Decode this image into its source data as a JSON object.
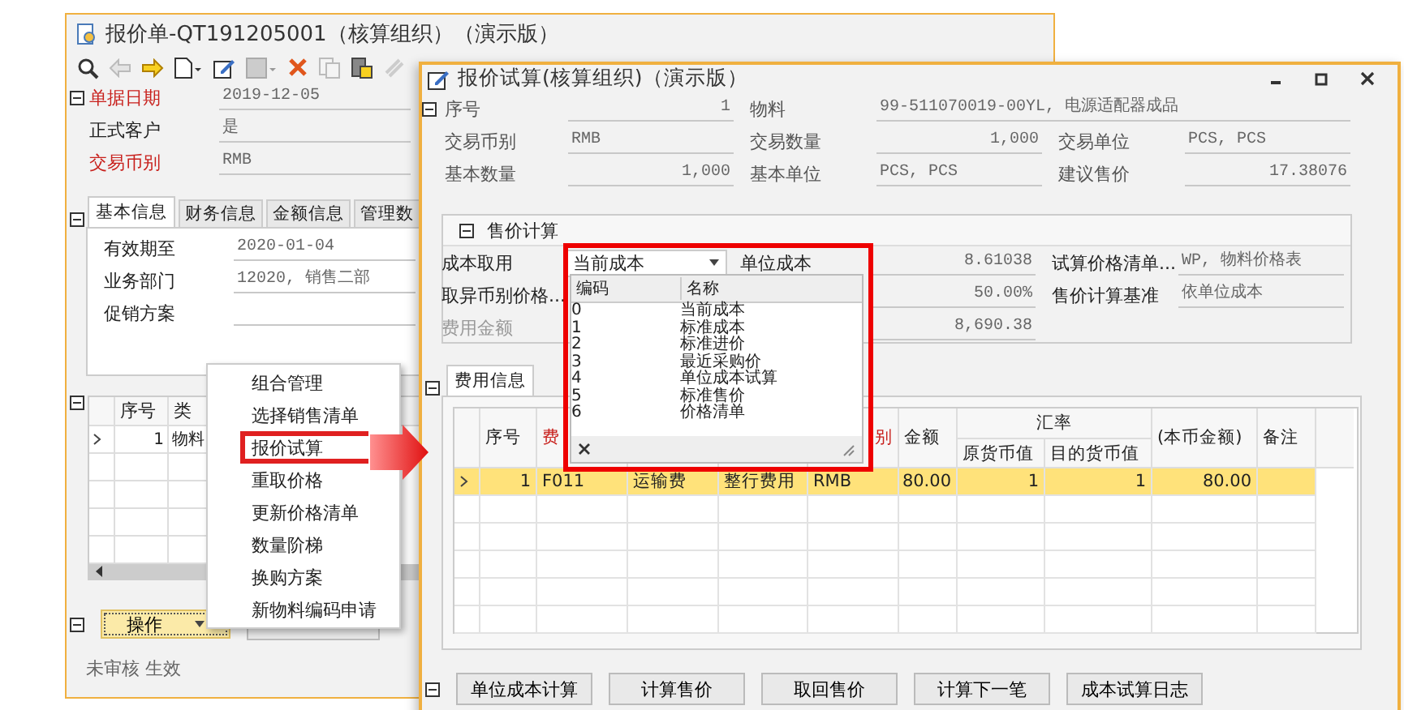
{
  "back_window": {
    "title": "报价单-QT191205001（核算组织）（演示版）",
    "header_fields": [
      {
        "label": "单据日期",
        "value": "2019-12-05",
        "required": true
      },
      {
        "label": "正式客户",
        "value": "是",
        "required": false
      },
      {
        "label": "交易币别",
        "value": "RMB",
        "required": true
      }
    ],
    "tabs": [
      {
        "label": "基本信息",
        "selected": true
      },
      {
        "label": "财务信息",
        "selected": false
      },
      {
        "label": "金额信息",
        "selected": false
      },
      {
        "label": "管理数",
        "selected": false
      }
    ],
    "tab_fields": [
      {
        "label": "有效期至",
        "value": "2020-01-04"
      },
      {
        "label": "业务部门",
        "value": "12020, 销售二部"
      },
      {
        "label": "促销方案"
      }
    ],
    "grid": {
      "columns": [
        "序号",
        "类"
      ],
      "rows": [
        {
          "cells": [
            "1",
            "物料"
          ]
        }
      ]
    },
    "action_button": "操作",
    "status": "未审核 生效"
  },
  "context_menu": {
    "items": [
      {
        "label": "组合管理",
        "selected": false
      },
      {
        "label": "选择销售清单",
        "selected": false
      },
      {
        "label": "报价试算",
        "selected": true
      },
      {
        "label": "重取价格",
        "selected": false
      },
      {
        "label": "更新价格清单",
        "selected": false
      },
      {
        "label": "数量阶梯",
        "selected": false
      },
      {
        "label": "换购方案",
        "selected": false
      },
      {
        "label": "新物料编码申请",
        "selected": false
      }
    ]
  },
  "front_window": {
    "title": "报价试算(核算组织)（演示版）",
    "field_rows": [
      {
        "fields": [
          {
            "label": "序号",
            "value": "1",
            "kind": "number"
          },
          {
            "label": "物料",
            "value": "99-511070019-00YL, 电源适配器成品",
            "kind": "text"
          }
        ]
      },
      {
        "fields": [
          {
            "label": "交易币别",
            "value": "RMB",
            "kind": "text"
          },
          {
            "label": "交易数量",
            "value": "1,000",
            "kind": "number"
          },
          {
            "label": "交易单位",
            "value": "PCS, PCS",
            "kind": "text"
          }
        ]
      },
      {
        "fields": [
          {
            "label": "基本数量",
            "value": "1,000",
            "kind": "number"
          },
          {
            "label": "基本单位",
            "value": "PCS, PCS",
            "kind": "text"
          },
          {
            "label": "建议售价",
            "value": "17.38076",
            "kind": "number"
          }
        ]
      }
    ],
    "section": {
      "title": "售价计算",
      "rows": [
        {
          "label": "成本取用",
          "disabled": false,
          "combo": "当前成本",
          "note": "单位成本",
          "value": "8.61038",
          "label2": "试算价格清单...",
          "value2": "WP, 物料价格表"
        },
        {
          "label": "取异币别价格...",
          "disabled": false,
          "value": "50.00%",
          "label2": "售价计算基准",
          "value2": "依单位成本"
        },
        {
          "label": "费用金额",
          "disabled": true,
          "value": "8,690.38"
        }
      ]
    },
    "dropdown": {
      "columns": [
        "编码",
        "名称"
      ],
      "rows": [
        {
          "code": "0",
          "name": "当前成本"
        },
        {
          "code": "1",
          "name": "标准成本"
        },
        {
          "code": "2",
          "name": "标准进价"
        },
        {
          "code": "3",
          "name": "最近采购价"
        },
        {
          "code": "4",
          "name": "单位成本试算"
        },
        {
          "code": "5",
          "name": "标准售价"
        },
        {
          "code": "6",
          "name": "价格清单"
        }
      ]
    },
    "tabs": [
      {
        "label": "费用信息",
        "selected": true
      }
    ],
    "grid": {
      "group_label": "汇率",
      "columns": [
        {
          "label": "序号",
          "required": false,
          "grouped": false
        },
        {
          "label": "费",
          "required": true,
          "grouped": false
        },
        {
          "grouped": false
        },
        {
          "grouped": false
        },
        {
          "label": "别",
          "required": true,
          "grouped": false
        },
        {
          "label": "金额",
          "required": false,
          "grouped": false
        },
        {
          "label": "原货币值",
          "required": false,
          "grouped": true
        },
        {
          "label": "目的货币值",
          "required": false,
          "grouped": true
        },
        {
          "label": "(本币金额)",
          "required": false,
          "grouped": false
        },
        {
          "label": "备注",
          "required": false,
          "grouped": false
        }
      ],
      "rows": [
        {
          "cells": [
            "1",
            "F011",
            "运输费",
            "整行费用",
            "RMB",
            "80.00",
            "1",
            "1",
            "80.00"
          ],
          "selected": true
        }
      ]
    },
    "buttons": [
      "单位成本计算",
      "计算售价",
      "取回售价",
      "计算下一笔",
      "成本试算日志"
    ]
  }
}
